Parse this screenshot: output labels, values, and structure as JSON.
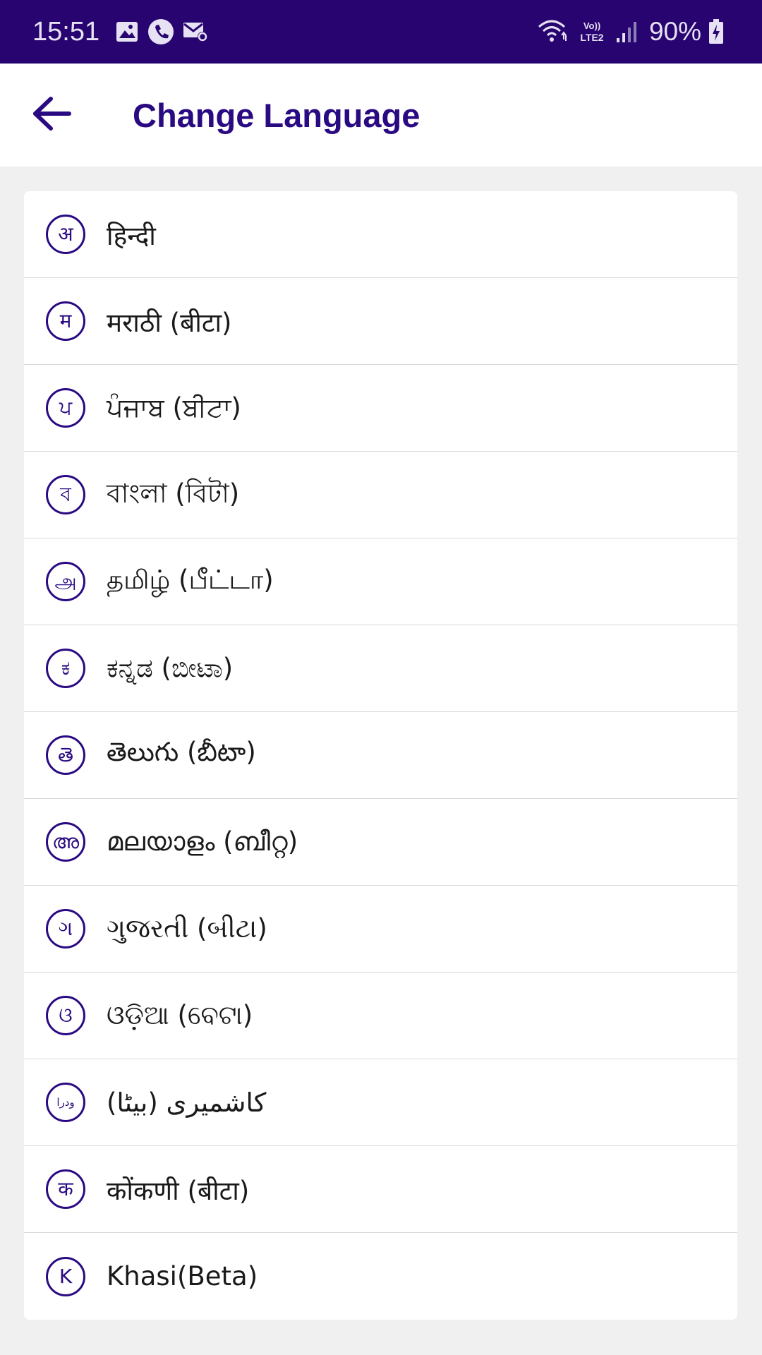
{
  "status_bar": {
    "time": "15:51",
    "left_icons": [
      "gallery-icon",
      "phone-call-icon",
      "mail-settings-icon"
    ],
    "network": "Vo)) LTE2",
    "battery_percent": "90%"
  },
  "app_bar": {
    "title": "Change Language",
    "back_icon": "arrow-left-icon"
  },
  "colors": {
    "status_bar_bg": "#270470",
    "accent": "#2a0a82",
    "page_bg": "#f0f0f0",
    "card_bg": "#ffffff"
  },
  "languages": [
    {
      "badge": "अ",
      "label": "हिन्दी"
    },
    {
      "badge": "म",
      "label": "मराठी (बीटा)"
    },
    {
      "badge": "ਪ",
      "label": "ਪੰਜਾਬ (ਬੀਟਾ)"
    },
    {
      "badge": "ব",
      "label": "বাংলা (বিটা)"
    },
    {
      "badge": "அ",
      "label": "தமிழ் (பீட்டா)"
    },
    {
      "badge": "ಕ",
      "label": "ಕನ್ನಡ (ಬೀಟಾ)"
    },
    {
      "badge": "తె",
      "label": "తెలుగు (బీటా)"
    },
    {
      "badge": "അ",
      "label": "മലയാളം (ബീറ്റ)"
    },
    {
      "badge": "ગ",
      "label": "ગુજરતી (બીટા)"
    },
    {
      "badge": "ଓ",
      "label": "ଓଡ଼ିଆ (ବେଟା)"
    },
    {
      "badge": "ودرا",
      "label": "کاشمیری (بیٹا)"
    },
    {
      "badge": "क",
      "label": "कोंकणी (बीटा)"
    },
    {
      "badge": "K",
      "label": "Khasi(Beta)"
    }
  ]
}
